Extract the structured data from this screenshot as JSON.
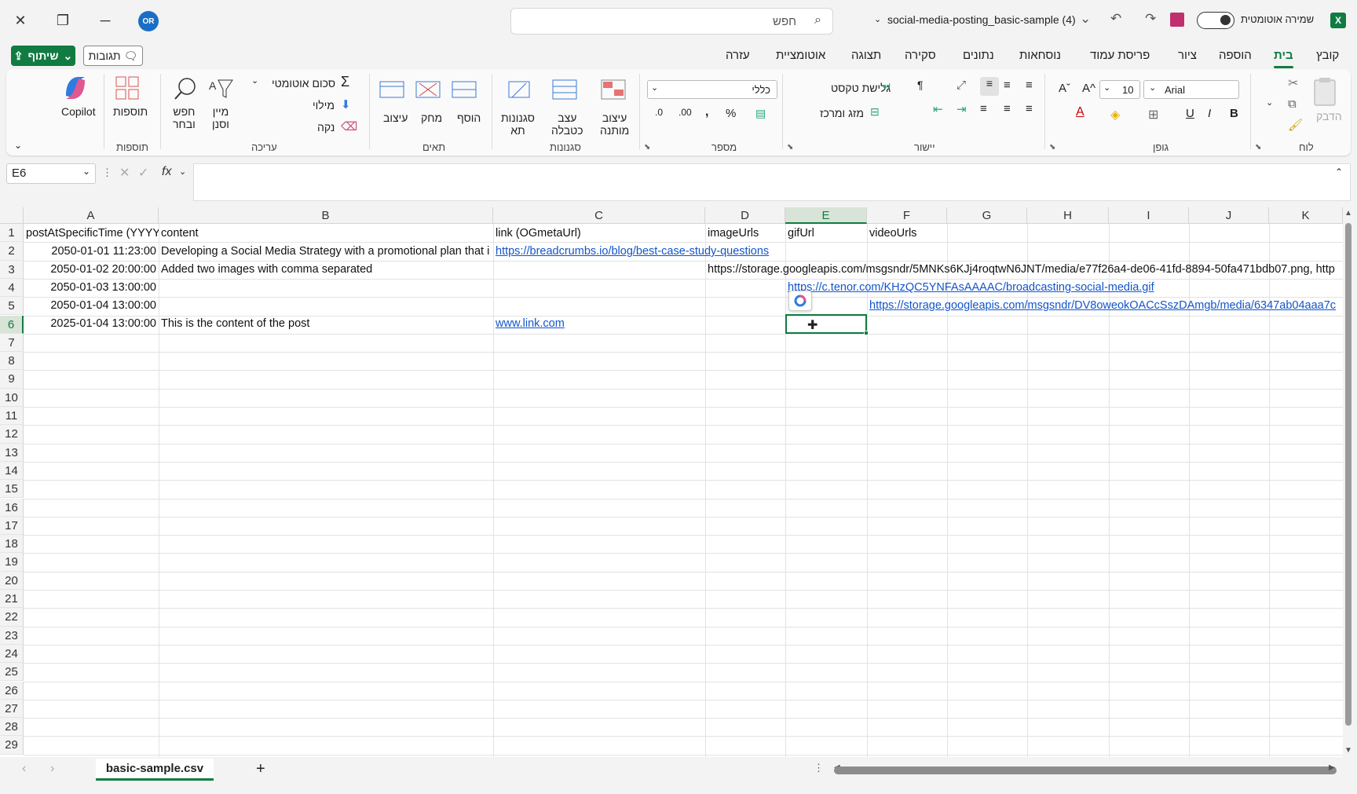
{
  "titlebar": {
    "avatar_initials": "OR",
    "search_placeholder": "חפש",
    "doc_title": "social-media-posting_basic-sample (4)",
    "autosave_label": "שמירה אוטומטית",
    "app_icon": "X"
  },
  "tabs": [
    {
      "label": "קובץ"
    },
    {
      "label": "בית"
    },
    {
      "label": "הוספה"
    },
    {
      "label": "ציור"
    },
    {
      "label": "פריסת עמוד"
    },
    {
      "label": "נוסחאות"
    },
    {
      "label": "נתונים"
    },
    {
      "label": "סקירה"
    },
    {
      "label": "תצוגה"
    },
    {
      "label": "אוטומציית"
    },
    {
      "label": "עזרה"
    }
  ],
  "share_label": "שיתוף",
  "comments_label": "תגובות",
  "ribbon": {
    "groups": {
      "clipboard": "לוח",
      "font": "גופן",
      "alignment": "יישור",
      "number": "מספר",
      "styles": "סגנונות",
      "cells": "תאים",
      "editing": "עריכה",
      "addins": "תוספות"
    },
    "paste": "הדבק",
    "font_name": "Arial",
    "font_size": "10",
    "bold": "B",
    "italic": "I",
    "underline": "U",
    "wrap_text": "גלישת טקסט",
    "merge_center": "מזג ומרכז",
    "number_format": "כללי",
    "conditional_fmt": [
      "עיצוב",
      "מותנה"
    ],
    "format_table": [
      "עצב",
      "כטבלה"
    ],
    "cell_styles": [
      "סגנונות",
      "תא"
    ],
    "insert": "הוסף",
    "delete": "מחק",
    "format": "עיצוב",
    "autosum": "סכום אוטומטי",
    "fill": "מילוי",
    "clear": "נקה",
    "sort_filter": [
      "מיין",
      "וסנן"
    ],
    "find_select": [
      "חפש",
      "ובחר"
    ],
    "addins": "תוספות",
    "copilot": "Copilot"
  },
  "formula_bar": {
    "name_box": "E6",
    "fx": "fx",
    "formula": ""
  },
  "columns": [
    "A",
    "B",
    "C",
    "D",
    "E",
    "F",
    "G",
    "H",
    "I",
    "J",
    "K"
  ],
  "rows": [
    "1",
    "2",
    "3",
    "4",
    "5",
    "6",
    "7",
    "8",
    "9",
    "10",
    "11",
    "12",
    "13",
    "14",
    "15",
    "16",
    "17",
    "18",
    "19",
    "20",
    "21",
    "22",
    "23",
    "24",
    "25",
    "26",
    "27",
    "28",
    "29"
  ],
  "cells": {
    "r1": [
      "postAtSpecificTime (YYYY",
      "content",
      "link (OGmetaUrl)",
      "imageUrls",
      "gifUrl",
      "videoUrls"
    ],
    "r2": [
      "2050-01-01 11:23:00",
      "Developing a Social Media Strategy with a promotional plan that i",
      "https://breadcrumbs.io/blog/best-case-study-questions"
    ],
    "r3": [
      "2050-01-02 20:00:00",
      "Added two images with comma separated",
      "https://storage.googleapis.com/msgsndr/5MNKs6KJj4roqtwN6JNT/media/e77f26a4-de06-41fd-8894-50fa471bdb07.png, http"
    ],
    "r4": [
      "2050-01-03 13:00:00",
      "https://c.tenor.com/KHzQC5YNFAsAAAAC/broadcasting-social-media.gif"
    ],
    "r5": [
      "2050-01-04 13:00:00",
      "https://storage.googleapis.com/msgsndr/DV8oweokOACcSszDAmgb/media/6347ab04aaa7c"
    ],
    "r6": [
      "2025-01-04 13:00:00",
      "This is the content of the post",
      "www.link.com"
    ]
  },
  "sheet_tab": "basic-sample.csv",
  "colors": {
    "accent": "#107c41",
    "link": "#1155cc",
    "save": "#c0306e"
  }
}
